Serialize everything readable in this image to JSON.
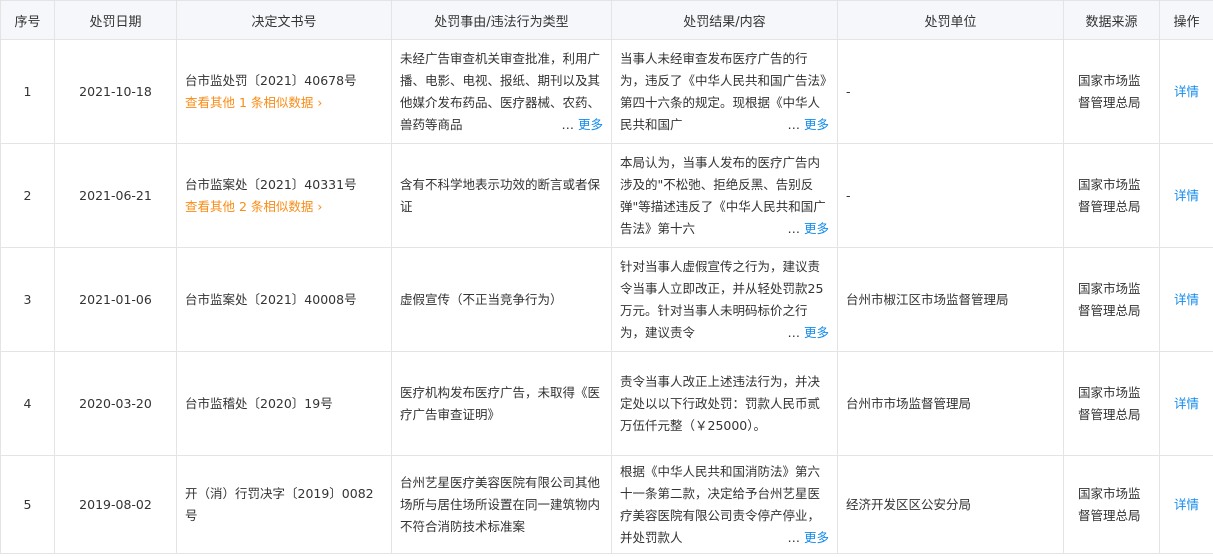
{
  "columns": [
    "序号",
    "处罚日期",
    "决定文书号",
    "处罚事由/违法行为类型",
    "处罚结果/内容",
    "处罚单位",
    "数据来源",
    "操作"
  ],
  "more_label": "更多",
  "ellipsis": "…",
  "rows": [
    {
      "index": "1",
      "date": "2021-10-18",
      "doc": "台市监处罚〔2021〕40678号",
      "similar": "查看其他 1 条相似数据 ›",
      "reason": "未经广告审查机关审查批准，利用广播、电影、电视、报纸、期刊以及其他媒介发布药品、医疗器械、农药、兽药等商品",
      "result": "当事人未经审查发布医疗广告的行为，违反了《中华人民共和国广告法》第四十六条的规定。现根据《中华人民共和国广",
      "unit": "-",
      "source": "国家市场监督管理总局",
      "action": "详情"
    },
    {
      "index": "2",
      "date": "2021-06-21",
      "doc": "台市监案处〔2021〕40331号",
      "similar": "查看其他 2 条相似数据 ›",
      "reason": "含有不科学地表示功效的断言或者保证",
      "result": "本局认为，当事人发布的医疗广告内涉及的\"不松弛、拒绝反黑、告别反弹\"等描述违反了《中华人民共和国广告法》第十六",
      "unit": "-",
      "source": "国家市场监督管理总局",
      "action": "详情"
    },
    {
      "index": "3",
      "date": "2021-01-06",
      "doc": "台市监案处〔2021〕40008号",
      "similar": "",
      "reason": "虚假宣传（不正当竞争行为）",
      "result": "针对当事人虚假宣传之行为，建议责令当事人立即改正，并从轻处罚款25万元。针对当事人未明码标价之行为，建议责令",
      "unit": "台州市椒江区市场监督管理局",
      "source": "国家市场监督管理总局",
      "action": "详情"
    },
    {
      "index": "4",
      "date": "2020-03-20",
      "doc": "台市监稽处〔2020〕19号",
      "similar": "",
      "reason": "医疗机构发布医疗广告，未取得《医疗广告审查证明》",
      "result": "责令当事人改正上述违法行为，并决定处以以下行政处罚：罚款人民币贰万伍仟元整（￥25000）。",
      "unit": "台州市市场监督管理局",
      "source": "国家市场监督管理总局",
      "action": "详情"
    },
    {
      "index": "5",
      "date": "2019-08-02",
      "doc": "开（消）行罚决字〔2019〕0082号",
      "similar": "",
      "reason": "台州艺星医疗美容医院有限公司其他场所与居住场所设置在同一建筑物内不符合消防技术标准案",
      "result": "根据《中华人民共和国消防法》第六十一条第二款，决定给予台州艺星医疗美容医院有限公司责令停产停业，并处罚款人",
      "unit": "经济开发区区公安分局",
      "source": "国家市场监督管理总局",
      "action": "详情"
    }
  ]
}
